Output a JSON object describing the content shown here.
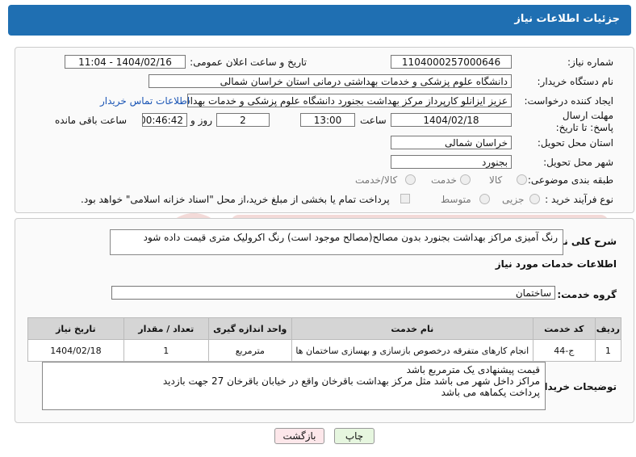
{
  "header": {
    "title": "جزئیات اطلاعات نیاز"
  },
  "form": {
    "need_number_label": "شماره نیاز:",
    "need_number": "1104000257000646",
    "announce_label": "تاریخ و ساعت اعلان عمومی:",
    "announce_value": "1404/02/16 - 11:04",
    "buyer_org_label": "نام دستگاه خریدار:",
    "buyer_org": "دانشگاه علوم پزشکی و خدمات بهداشتی درمانی استان خراسان شمالی",
    "creator_label": "ایجاد کننده درخواست:",
    "creator": "عزیز ایزانلو کارپرداز مرکز بهداشت بجنورد دانشگاه علوم پزشکی و خدمات بهداشتی درمانی",
    "contact_link": "اطلاعات تماس خریدار",
    "deadline_label": "مهلت ارسال پاسخ: تا تاریخ:",
    "deadline_date": "1404/02/18",
    "time_label": "ساعت",
    "deadline_time": "13:00",
    "days_value": "2",
    "days_label": "روز و",
    "remaining_time": "00:46:42",
    "remaining_label": "ساعت باقی مانده",
    "province_label": "استان محل تحویل:",
    "province": "خراسان شمالی",
    "city_label": "شهر محل تحویل:",
    "city": "بجنورد",
    "category_label": "طبقه بندی موضوعی:",
    "category_options": [
      "کالا",
      "خدمت",
      "کالا/خدمت"
    ],
    "process_label": "نوع فرآیند خرید :",
    "process_options": [
      "جزیی",
      "متوسط"
    ],
    "payment_note": "پرداخت تمام یا بخشی از مبلغ خرید،از محل \"اسناد خزانه اسلامی\" خواهد بود."
  },
  "details": {
    "summary_label": "شرح کلی نیاز:",
    "summary": "رنگ آمیزی مراکز بهداشت بجنورد بدون مصالح(مصالح موجود است) رنگ اکرولیک متری قیمت داده شود",
    "services_title": "اطلاعات خدمات مورد نیاز",
    "service_group_label": "گروه خدمت:",
    "service_group": "ساختمان",
    "table": {
      "headers": [
        "ردیف",
        "کد خدمت",
        "نام خدمت",
        "واحد اندازه گیری",
        "تعداد / مقدار",
        "تاریخ نیاز"
      ],
      "rows": [
        [
          "1",
          "ج-44",
          "انجام کارهای متفرقه درخصوص بازسازی و بهسازی ساختمان ها",
          "مترمربع",
          "1",
          "1404/02/18"
        ]
      ]
    },
    "buyer_notes_label": "توضیحات خریدار:",
    "buyer_notes": [
      "قیمت پیشنهادی یک مترمربع باشد",
      "مراکز داخل شهر می باشد مثل مرکز بهداشت باقرخان واقع در خیابان باقرخان 27 جهت بازدید",
      "پرداخت یکماهه می باشد"
    ]
  },
  "buttons": {
    "print": "چاپ",
    "back": "بازگشت"
  },
  "colors": {
    "header": "#1f6fb2",
    "print_btn": "#e6f6df",
    "back_btn": "#fde7ea"
  }
}
